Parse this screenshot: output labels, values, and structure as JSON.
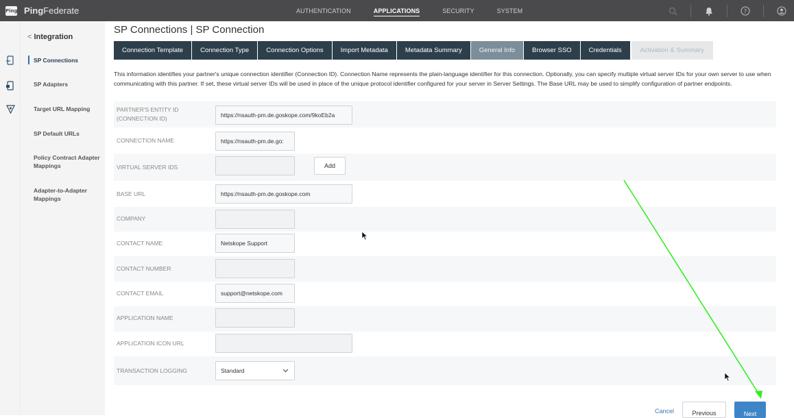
{
  "app": {
    "logo_text": "Ping",
    "brand_bold": "Ping",
    "brand_rest": "Federate"
  },
  "topnav": [
    {
      "label": "AUTHENTICATION",
      "active": false
    },
    {
      "label": "APPLICATIONS",
      "active": true
    },
    {
      "label": "SECURITY",
      "active": false
    },
    {
      "label": "SYSTEM",
      "active": false
    }
  ],
  "topicons": [
    "search-icon",
    "bell-icon",
    "help-icon",
    "user-icon"
  ],
  "sidebar": {
    "back_label": "Integration",
    "items": [
      {
        "label": "SP Connections",
        "active": true
      },
      {
        "label": "SP Adapters"
      },
      {
        "label": "Target URL Mapping"
      },
      {
        "label": "SP Default URLs"
      },
      {
        "label": "Policy Contract Adapter Mappings"
      },
      {
        "label": "Adapter-to-Adapter Mappings"
      }
    ]
  },
  "page": {
    "title": "SP Connections | SP Connection"
  },
  "tabs": [
    {
      "label": "Connection Template"
    },
    {
      "label": "Connection Type"
    },
    {
      "label": "Connection Options"
    },
    {
      "label": "Import Metadata"
    },
    {
      "label": "Metadata Summary"
    },
    {
      "label": "General Info",
      "current": true
    },
    {
      "label": "Browser SSO"
    },
    {
      "label": "Credentials"
    },
    {
      "label": "Activation & Summary",
      "disabled": true
    }
  ],
  "description": "This information identifies your partner's unique connection identifier (Connection ID). Connection Name represents the plain-language identifier for this connection. Optionally, you can specify multiple virtual server IDs for your own server to use when communicating with this partner. If set, these virtual server IDs will be used in place of the unique protocol identifier configured for your server in Server Settings. The Base URL may be used to simplify configuration of partner endpoints.",
  "form": {
    "entity_id": {
      "label_line1": "PARTNER'S ENTITY ID",
      "label_line2": "(CONNECTION ID)",
      "value": "https://nsauth-pm.de.goskope.com/9koEb2a"
    },
    "connection_name": {
      "label": "CONNECTION NAME",
      "value": "https://nsauth-pm.de.go:"
    },
    "virtual_server_ids": {
      "label": "VIRTUAL SERVER IDS",
      "value": "",
      "add_label": "Add"
    },
    "base_url": {
      "label": "BASE URL",
      "value": "https://nsauth-pm.de.goskope.com"
    },
    "company": {
      "label": "COMPANY",
      "value": ""
    },
    "contact_name": {
      "label": "CONTACT NAME",
      "value": "Netskope Support"
    },
    "contact_number": {
      "label": "CONTACT NUMBER",
      "value": ""
    },
    "contact_email": {
      "label": "CONTACT EMAIL",
      "value": "support@netskope.com"
    },
    "application_name": {
      "label": "APPLICATION NAME",
      "value": ""
    },
    "application_icon_url": {
      "label": "APPLICATION ICON URL",
      "value": ""
    },
    "transaction_logging": {
      "label": "TRANSACTION LOGGING",
      "value": "Standard"
    }
  },
  "footer": {
    "cancel": "Cancel",
    "previous": "Previous",
    "next": "Next"
  },
  "colors": {
    "topbar": "#4a4a4c",
    "tab_active": "#2d3f4b",
    "tab_current": "#7c8e9a",
    "accent": "#3d85c6",
    "annotation_arrow": "#33ee22"
  }
}
